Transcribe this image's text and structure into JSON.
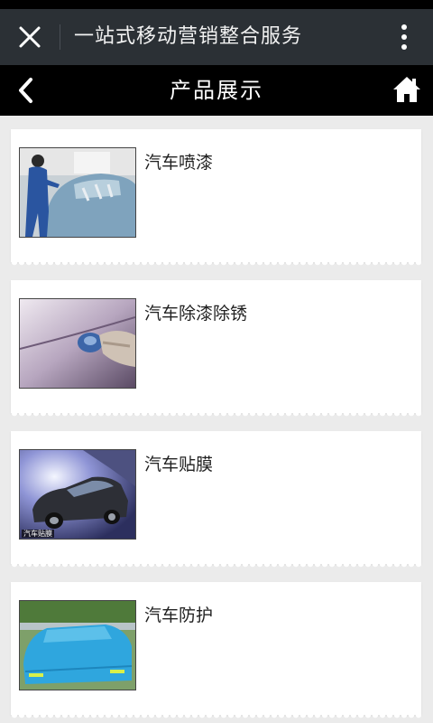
{
  "app_bar": {
    "title": "一站式移动营销整合服务"
  },
  "page_header": {
    "title": "产品展示"
  },
  "products": [
    {
      "name": "汽车喷漆"
    },
    {
      "name": "汽车除漆除锈"
    },
    {
      "name": "汽车贴膜",
      "thumb_caption": "汽车贴膜"
    },
    {
      "name": "汽车防护"
    }
  ],
  "icons": {
    "close": "close-icon",
    "more": "more-vertical-icon",
    "back": "chevron-left-icon",
    "home": "home-icon"
  },
  "colors": {
    "app_bar_bg": "#2b3035",
    "header_bg": "#000000",
    "page_bg": "#ebebeb",
    "card_bg": "#ffffff"
  }
}
